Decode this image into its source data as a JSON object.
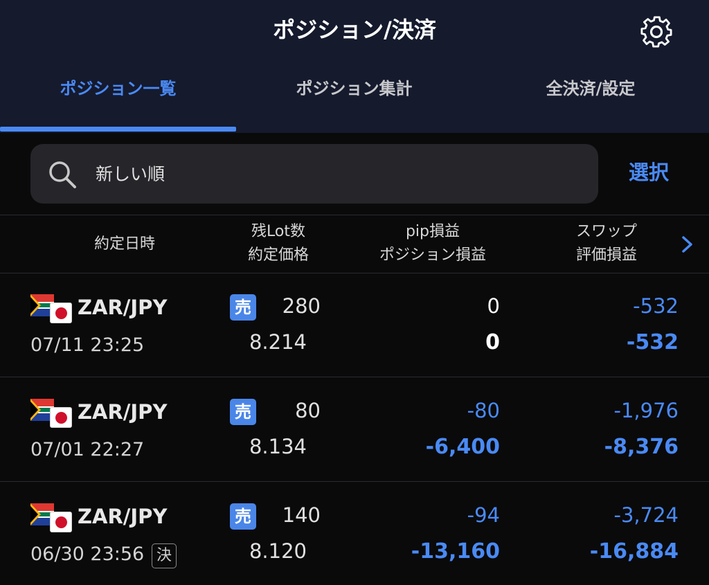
{
  "header": {
    "title": "ポジション/決済",
    "settings_icon": "gear-icon",
    "tabs": [
      {
        "label": "ポジション一覧",
        "active": true
      },
      {
        "label": "ポジション集計",
        "active": false
      },
      {
        "label": "全決済/設定",
        "active": false
      }
    ]
  },
  "search": {
    "icon": "search-icon",
    "sort_label": "新しい順",
    "select_label": "選択"
  },
  "columns": {
    "date": "約定日時",
    "lot_line1": "残Lot数",
    "lot_line2": "約定価格",
    "pip_line1": "pip損益",
    "pip_line2": "ポジション損益",
    "swap_line1": "スワップ",
    "swap_line2": "評価損益",
    "more_icon": "chevron-right-icon"
  },
  "colors": {
    "accent": "#4a8af4",
    "header_bg": "#151a2d",
    "sell_badge": "#4a86e8"
  },
  "positions": [
    {
      "pair": "ZAR/JPY",
      "datetime": "07/11 23:25",
      "side": "売",
      "lots": "280",
      "price": "8.214",
      "pip": "0",
      "pl": "0",
      "swap": "-532",
      "eval": "-532",
      "settle_mark": ""
    },
    {
      "pair": "ZAR/JPY",
      "datetime": "07/01 22:27",
      "side": "売",
      "lots": "80",
      "price": "8.134",
      "pip": "-80",
      "pl": "-6,400",
      "swap": "-1,976",
      "eval": "-8,376",
      "settle_mark": ""
    },
    {
      "pair": "ZAR/JPY",
      "datetime": "06/30 23:56",
      "side": "売",
      "lots": "140",
      "price": "8.120",
      "pip": "-94",
      "pl": "-13,160",
      "swap": "-3,724",
      "eval": "-16,884",
      "settle_mark": "決"
    }
  ]
}
